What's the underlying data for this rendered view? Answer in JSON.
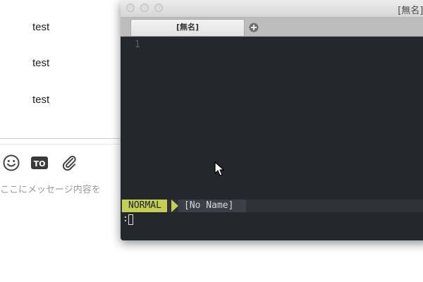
{
  "chat": {
    "messages": [
      "test",
      "test",
      "test"
    ],
    "composer": {
      "placeholder": "ここにメッセージ内容を"
    },
    "toolbar": {
      "emoji_icon": "smiley-icon",
      "to_icon": "to-icon",
      "to_label": "TO",
      "attach_icon": "paperclip-icon"
    }
  },
  "vim": {
    "window_title": "[無名] –",
    "tab_label": "[無名]",
    "new_tab_icon": "plus-circle-icon",
    "line_numbers": [
      "1"
    ],
    "mode": "NORMAL",
    "buffer_name": "[No Name]",
    "command_prompt": ":"
  },
  "colors": {
    "editor_bg": "#24272b",
    "mode_bg": "#c4cf52",
    "titlebar": "#e0e0e0"
  }
}
